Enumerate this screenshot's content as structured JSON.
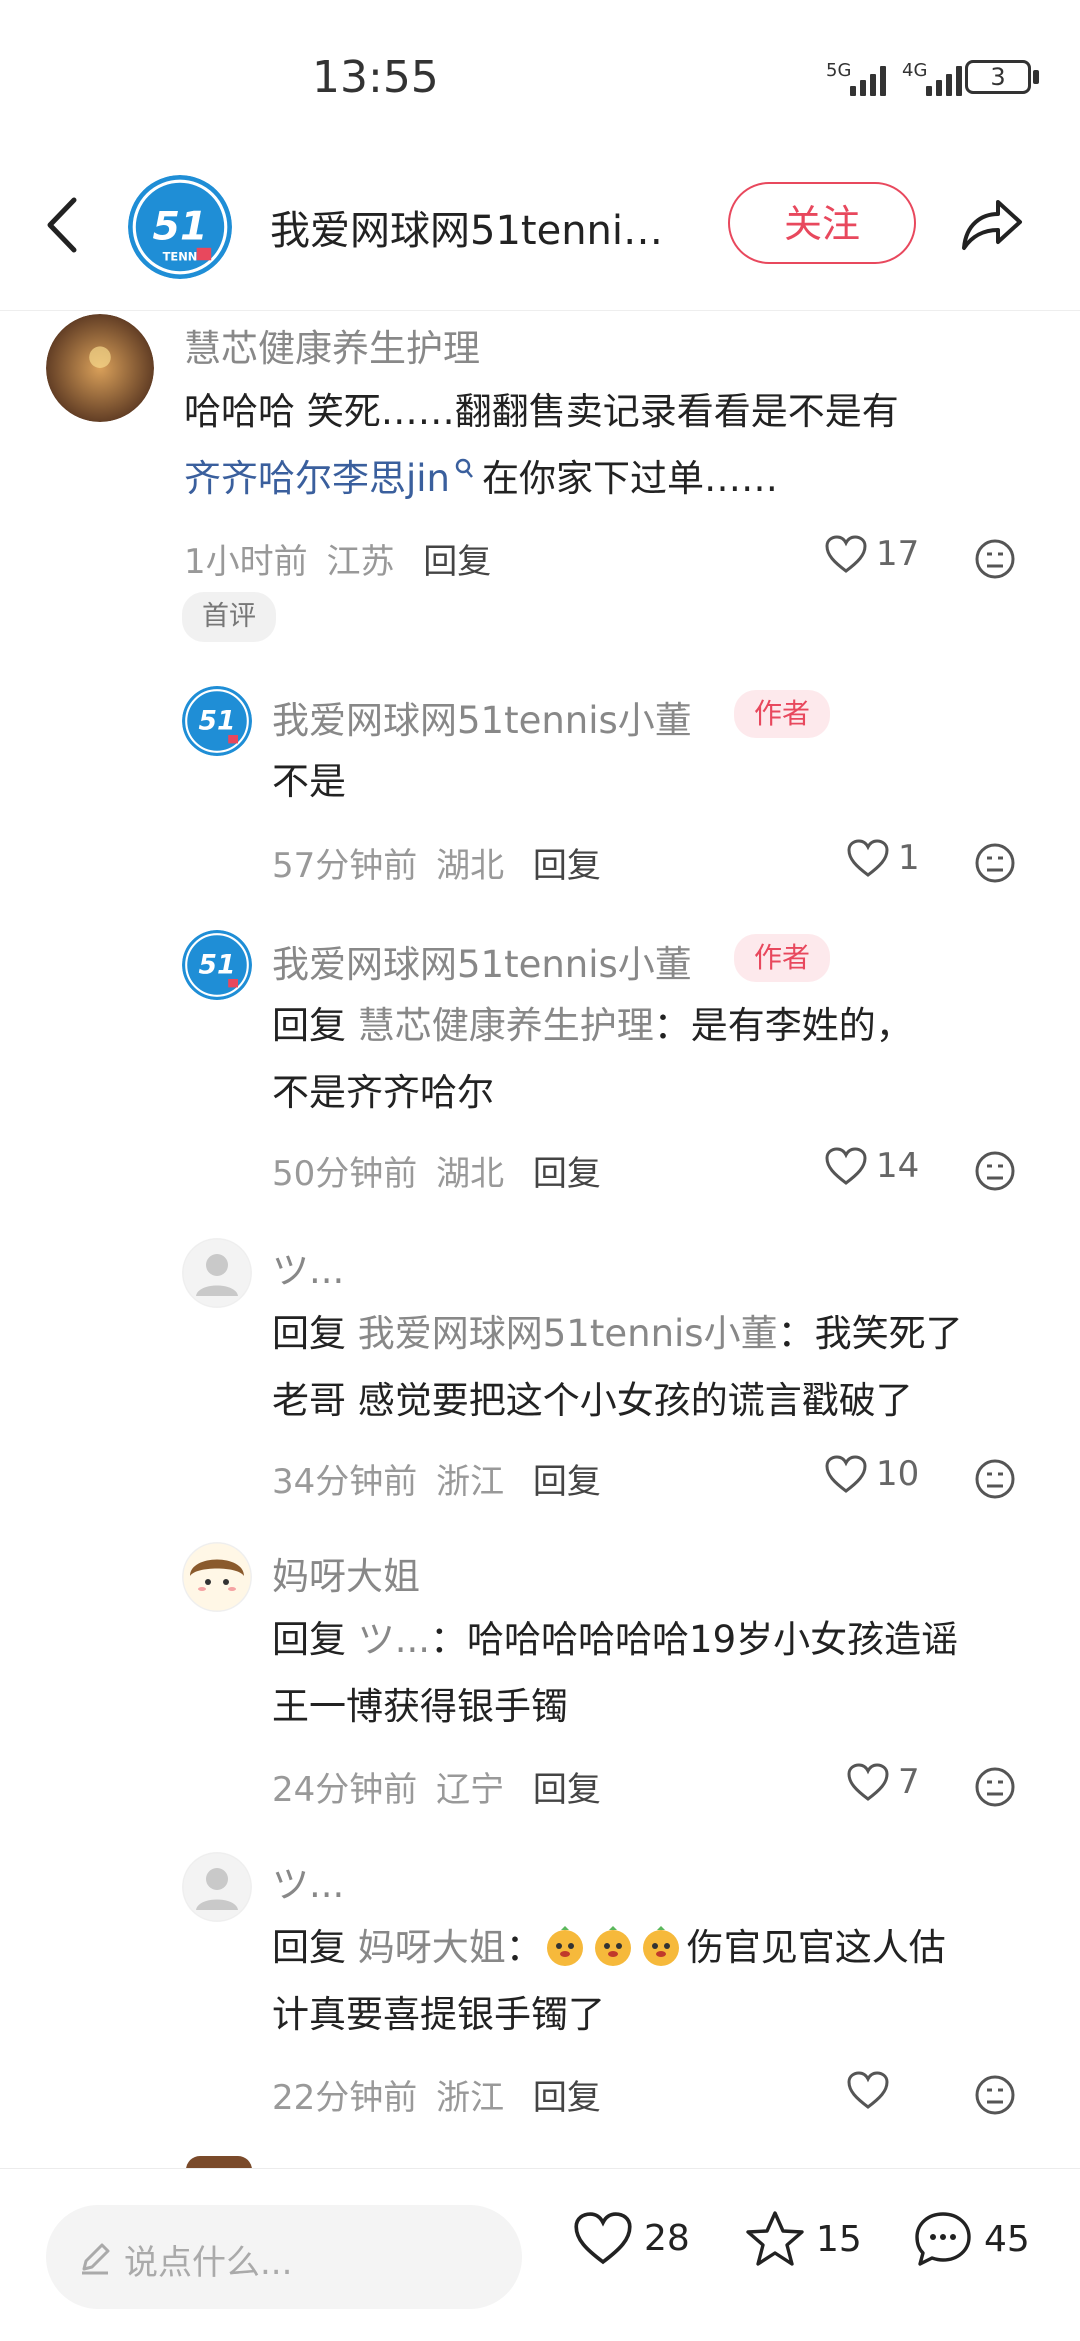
{
  "status_bar": {
    "time": "13:55",
    "net1": "5G",
    "net2": "4G",
    "battery": "3"
  },
  "header": {
    "title": "我爱网球网51tenni…",
    "follow_label": "关注"
  },
  "comments": [
    {
      "author": "慧芯健康养生护理",
      "text_before": "哈哈哈 笑死……翻翻售卖记录看看是不是有",
      "mention": "齐齐哈尔李思jin",
      "text_after": "在你家下过单……",
      "time": "1小时前",
      "location": "江苏",
      "reply": "回复",
      "likes": "17",
      "badge": "首评"
    }
  ],
  "replies": [
    {
      "author": "我爱网球网51tennis小董",
      "tag": "作者",
      "reply_prefix": "",
      "reply_to": "",
      "text": "不是",
      "time": "57分钟前",
      "location": "湖北",
      "reply": "回复",
      "likes": "1"
    },
    {
      "author": "我爱网球网51tennis小董",
      "tag": "作者",
      "reply_prefix": "回复",
      "reply_to": "慧芯健康养生护理",
      "text_line1": "：是有李姓的，",
      "text_line2": "不是齐齐哈尔",
      "time": "50分钟前",
      "location": "湖北",
      "reply": "回复",
      "likes": "14"
    },
    {
      "author": "ツ...",
      "reply_prefix": "回复",
      "reply_to": "我爱网球网51tennis小董",
      "text_line1": "：我笑死了",
      "text_line2": "老哥 感觉要把这个小女孩的谎言戳破了",
      "time": "34分钟前",
      "location": "浙江",
      "reply": "回复",
      "likes": "10"
    },
    {
      "author": "妈呀大姐",
      "reply_prefix": "回复",
      "reply_to": "ツ...",
      "text_line1": "：哈哈哈哈哈哈19岁小女孩造谣",
      "text_line2": "王一博获得银手镯",
      "time": "24分钟前",
      "location": "辽宁",
      "reply": "回复",
      "likes": "7"
    },
    {
      "author": "ツ...",
      "reply_prefix": "回复",
      "reply_to": "妈呀大姐",
      "text_line1_tail": "伤官见官这人估",
      "text_line2": "计真要喜提银手镯了",
      "time": "22分钟前",
      "location": "浙江",
      "reply": "回复",
      "likes": ""
    }
  ],
  "bottom_bar": {
    "placeholder": "说点什么...",
    "likes": "28",
    "favorites": "15",
    "comments": "45"
  },
  "colors": {
    "accent": "#e8485d",
    "link": "#3a5f9d",
    "logo_blue": "#1f8ed6"
  }
}
